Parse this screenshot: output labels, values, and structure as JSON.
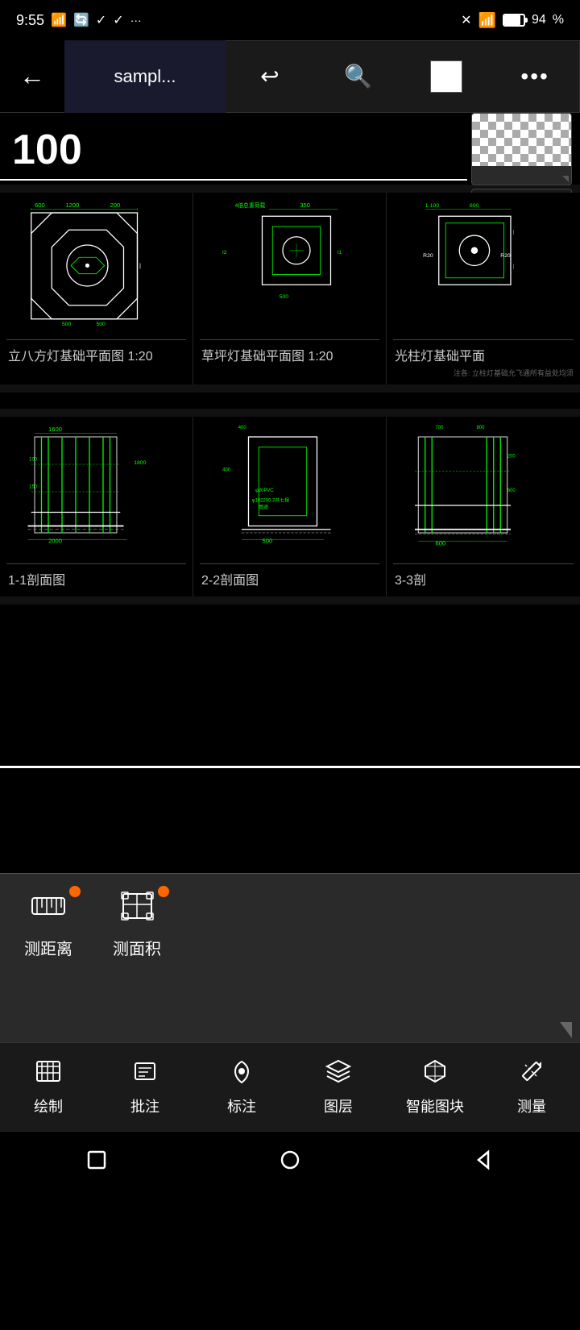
{
  "statusBar": {
    "time": "9:55",
    "battery": "94"
  },
  "navBar": {
    "backLabel": "←",
    "titleLabel": "sampl...",
    "undoLabel": "↩",
    "searchLabel": "🔍",
    "moreLabel": "···"
  },
  "scaleIndicator": {
    "value": "100"
  },
  "drawings": {
    "row1": [
      {
        "label": "立八方灯基础平面图 1:20",
        "type": "octagon"
      },
      {
        "label": "草坪灯基础平面图 1:20",
        "type": "rect_circle"
      },
      {
        "label": "光柱灯基础平面",
        "sublabel": "注各: 立柱灯基础允飞通所有益处均须",
        "type": "rect_circle2"
      }
    ],
    "row2": [
      {
        "label": "1-1剖面图",
        "type": "section1"
      },
      {
        "label": "2-2剖面图",
        "type": "section2"
      },
      {
        "label": "3-3剖",
        "type": "section3"
      }
    ]
  },
  "bottomPopup": {
    "tools": [
      {
        "id": "measure-distance",
        "label": "测距离",
        "icon": "ruler-distance"
      },
      {
        "id": "measure-area",
        "label": "测面积",
        "icon": "ruler-area"
      }
    ]
  },
  "bottomNav": {
    "items": [
      {
        "id": "draw",
        "label": "绘制",
        "icon": "draw-icon"
      },
      {
        "id": "annotate",
        "label": "批注",
        "icon": "annotate-icon"
      },
      {
        "id": "mark",
        "label": "标注",
        "icon": "mark-icon"
      },
      {
        "id": "layers",
        "label": "图层",
        "icon": "layers-icon"
      },
      {
        "id": "smart-block",
        "label": "智能图块",
        "icon": "smart-block-icon"
      },
      {
        "id": "measure",
        "label": "测量",
        "icon": "measure-icon"
      }
    ]
  },
  "androidNav": {
    "square": "□",
    "circle": "○",
    "triangle": "◁"
  }
}
